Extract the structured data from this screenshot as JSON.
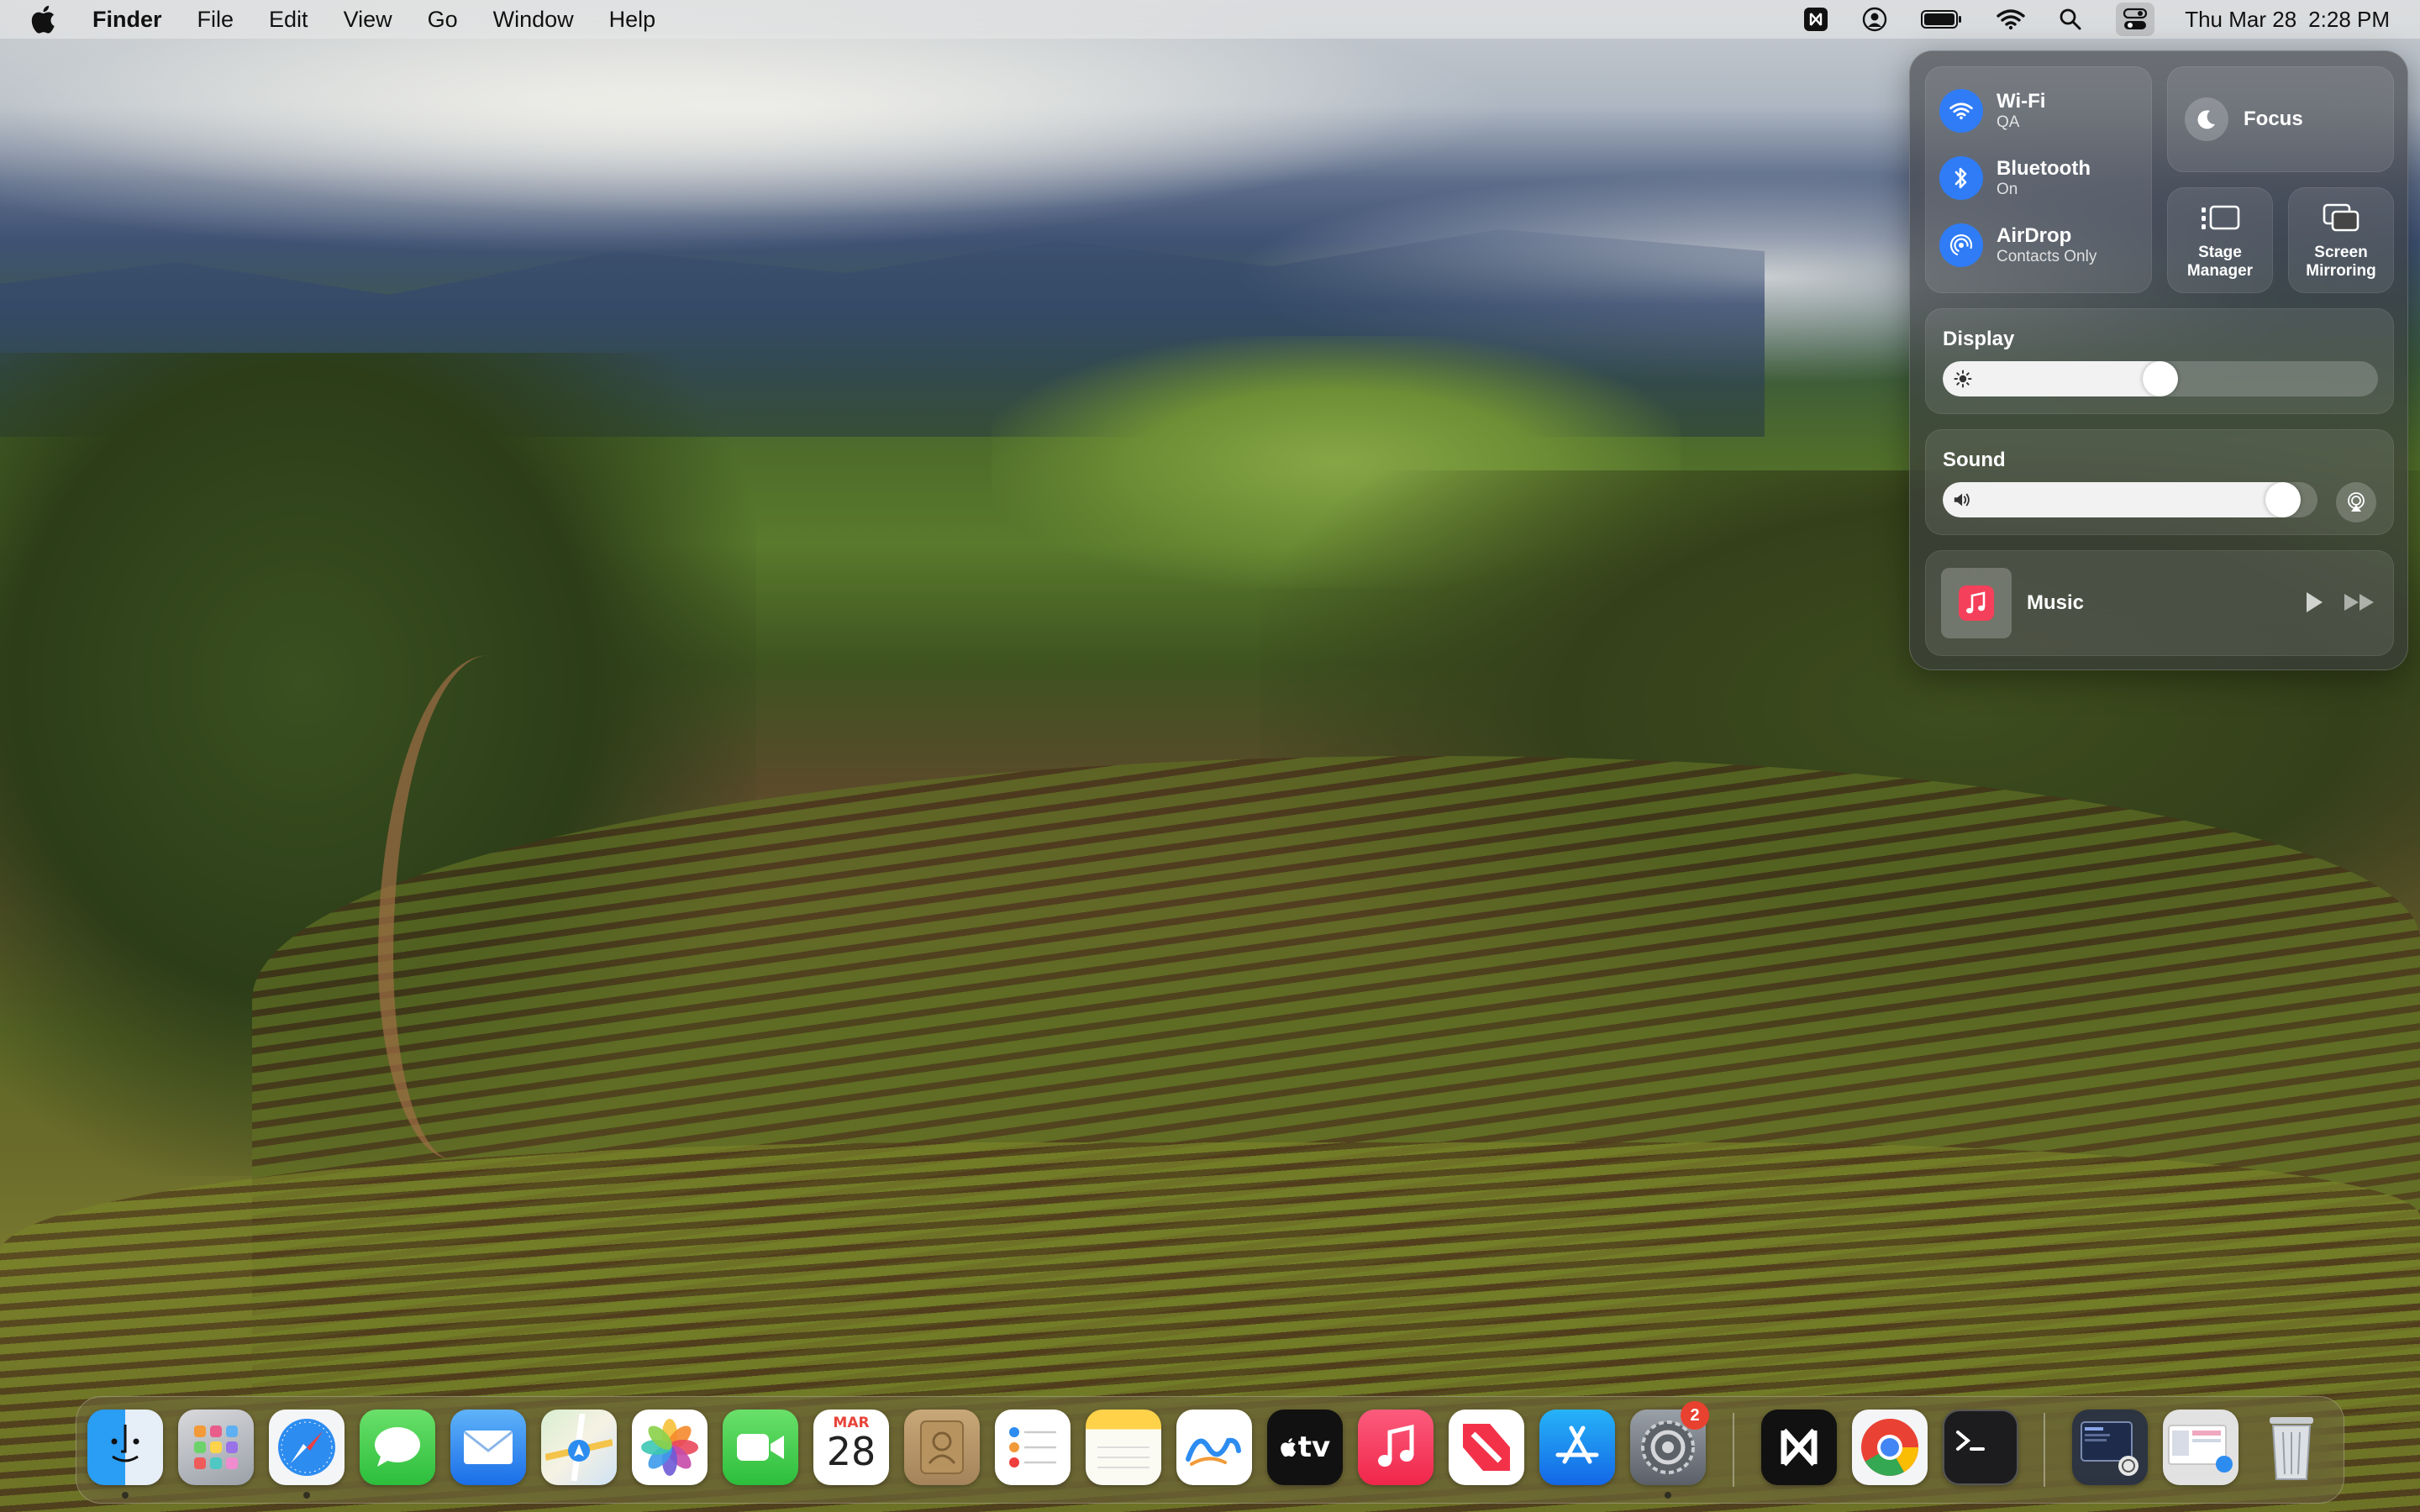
{
  "menubar": {
    "app_name": "Finder",
    "menus": [
      "File",
      "Edit",
      "View",
      "Go",
      "Window",
      "Help"
    ],
    "date": "Thu Mar 28",
    "time": "2:28 PM"
  },
  "control_center": {
    "wifi": {
      "label": "Wi-Fi",
      "status": "QA"
    },
    "bluetooth": {
      "label": "Bluetooth",
      "status": "On"
    },
    "airdrop": {
      "label": "AirDrop",
      "status": "Contacts Only"
    },
    "focus": {
      "label": "Focus"
    },
    "stage_manager": {
      "line1": "Stage",
      "line2": "Manager"
    },
    "screen_mirroring": {
      "line1": "Screen",
      "line2": "Mirroring"
    },
    "display": {
      "label": "Display",
      "level": 0.5
    },
    "sound": {
      "label": "Sound",
      "level": 0.95
    },
    "music": {
      "label": "Music"
    },
    "accent_color": "#2f7cf6"
  },
  "dock": {
    "apps": [
      "Finder",
      "Launchpad",
      "Safari",
      "Messages",
      "Mail",
      "Maps",
      "Photos",
      "FaceTime",
      "Calendar",
      "Contacts",
      "Reminders",
      "Notes",
      "Freeform",
      "TV",
      "Music",
      "News",
      "App Store",
      "System Settings",
      "Perplexity",
      "Chrome",
      "Terminal",
      "Downloads",
      "Documents",
      "Trash"
    ],
    "calendar_month": "MAR",
    "calendar_day": "28",
    "tv_label": "tv",
    "settings_badge": "2"
  }
}
